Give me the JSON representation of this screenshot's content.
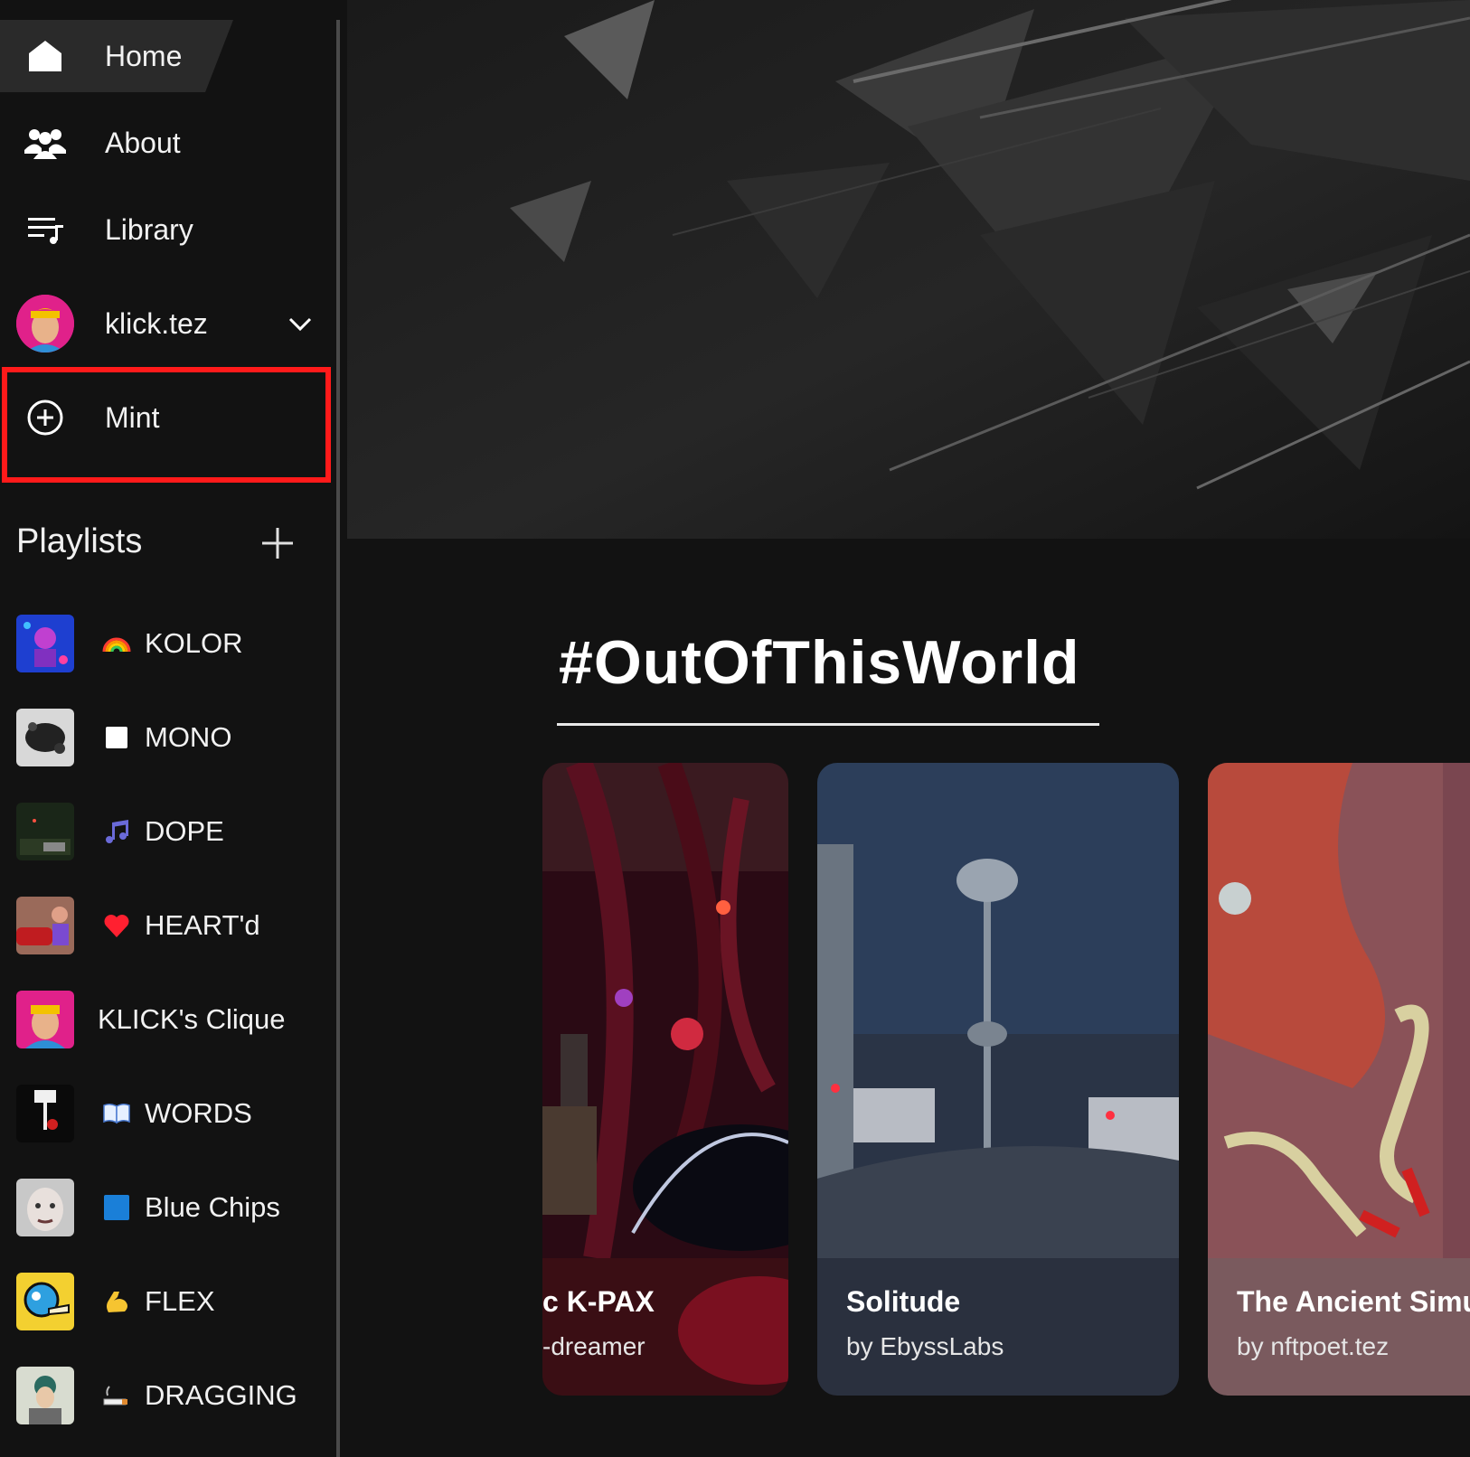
{
  "nav": {
    "home": "Home",
    "about": "About",
    "library": "Library",
    "account": "klick.tez",
    "mint": "Mint"
  },
  "playlists": {
    "title": "Playlists",
    "items": [
      {
        "emoji": "🌈",
        "label": "KOLOR"
      },
      {
        "emoji": "⬜",
        "label": "MONO"
      },
      {
        "emoji": "🎶",
        "label": "DOPE"
      },
      {
        "emoji": "❤️",
        "label": "HEART'd"
      },
      {
        "emoji": "",
        "label": "KLICK's Clique"
      },
      {
        "emoji": "📖",
        "label": "WORDS"
      },
      {
        "emoji": "🟦",
        "label": "Blue Chips"
      },
      {
        "emoji": "💪",
        "label": "FLEX"
      },
      {
        "emoji": "🚬",
        "label": "DRAGGING"
      }
    ]
  },
  "main": {
    "section_title": "#OutOfThisWorld",
    "cards": [
      {
        "title": "c K-PAX",
        "byline": "-dreamer"
      },
      {
        "title": "Solitude",
        "byline": "by EbyssLabs"
      },
      {
        "title": "The Ancient Simu",
        "byline": "by nftpoet.tez"
      }
    ]
  },
  "colors": {
    "background": "#121212",
    "highlight": "#ff1a1a",
    "text": "#ffffff"
  }
}
